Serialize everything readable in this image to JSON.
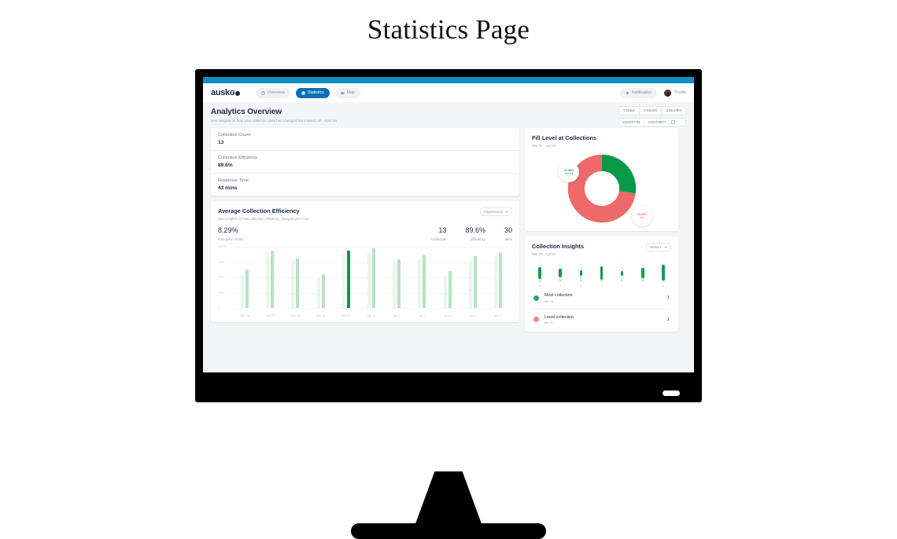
{
  "page": {
    "title": "Statistics Page"
  },
  "nav": {
    "logo": "ausko",
    "items": [
      {
        "label": "Overview",
        "icon": "dashboard-icon",
        "active": false
      },
      {
        "label": "Statistics",
        "icon": "chart-icon",
        "active": true
      },
      {
        "label": "Map",
        "icon": "map-icon",
        "active": false
      }
    ],
    "notification_label": "Notification",
    "profile_label": "Profile"
  },
  "header": {
    "title": "Analytics Overview",
    "subtitle": "See insights on how your collection data has changed from March 28 - April 28",
    "segments": [
      "7 Days",
      "1 Month",
      "3 Months"
    ],
    "date_from": "2022/07/31",
    "date_sep": "-",
    "date_to": "2022/08/07"
  },
  "stats": [
    {
      "label": "Collection Count",
      "value": "13"
    },
    {
      "label": "Collection Efficiency",
      "value": "89.6%"
    },
    {
      "label": "Response Time",
      "value": "43 mins"
    }
  ],
  "fill_level": {
    "title": "Fill Level at Collections",
    "range": "Mar 28 - Apr 01",
    "green_pct": "27.36%",
    "green_label": "Not full",
    "red_pct": "72.64%",
    "red_label": "Full",
    "green_color": "#089949",
    "red_color": "#ee6a6a"
  },
  "efficiency": {
    "title": "Average Collection Efficiency",
    "subtitle": "See insights on how collection efficiency changed over time",
    "dropdown": "Impressions",
    "main_value": "8.29%",
    "main_label": "from prev. month",
    "kpis": [
      {
        "value": "13",
        "label": "Collection"
      },
      {
        "value": "89.6%",
        "label": "Efficiency"
      },
      {
        "value": "30",
        "label": "Mins"
      }
    ]
  },
  "insights": {
    "title": "Collection Insights",
    "range": "Mar 28 - Apr 01",
    "dropdown": "Week 1",
    "rows": [
      {
        "title": "Most collection",
        "sub": "Bin 04",
        "count": "1",
        "color": "#2bab5d"
      },
      {
        "title": "Least collection",
        "sub": "Bin 01",
        "count": "1",
        "color": "#f4867f"
      }
    ]
  },
  "chart_data": [
    {
      "type": "bar",
      "title": "Average Collection Efficiency",
      "xlabel": "",
      "ylabel": "",
      "ylim": [
        0,
        100
      ],
      "ytick_labels": [
        "100 %",
        "75%",
        "50%",
        "25%",
        "0"
      ],
      "ytick_values": [
        100,
        75,
        50,
        25,
        0
      ],
      "grid": true,
      "categories": [
        "Mar 26",
        "Mar 27",
        "Mar 28",
        "Mar 29",
        "Mar 30",
        "Mar 31",
        "Apr 1",
        "Apr 2",
        "Apr 3",
        "Apr 4",
        "Apr 5"
      ],
      "series": [
        {
          "name": "Previous",
          "color": "#e9f6ee",
          "values": [
            54,
            91,
            78,
            49,
            87,
            90,
            75,
            80,
            53,
            77,
            85
          ]
        },
        {
          "name": "Current",
          "color": "#b7e2c6",
          "values": [
            63,
            94,
            81,
            55,
            93,
            97,
            79,
            86,
            60,
            84,
            90
          ]
        }
      ],
      "highlight": {
        "category": "Mar 30",
        "series": "Current",
        "color": "#089949",
        "value": 93
      }
    },
    {
      "type": "pie",
      "title": "Fill Level at Collections",
      "subtitle": "Mar 28 - Apr 01",
      "labels": [
        "Not full",
        "Full"
      ],
      "values": [
        27.36,
        72.64
      ],
      "value_labels": [
        "27.36%",
        "72.64%"
      ],
      "colors": [
        "#089949",
        "#ee6a6a"
      ],
      "donut": true
    },
    {
      "type": "bar",
      "title": "Collection Insights",
      "subtitle": "Mar 28 - Apr 01",
      "categories": [
        "M",
        "T",
        "W",
        "T",
        "F",
        "S",
        "S"
      ],
      "values": [
        62,
        48,
        30,
        72,
        26,
        55,
        82
      ],
      "color": "#159b48",
      "track_color": "#e3f4e9",
      "ylim": [
        0,
        100
      ]
    }
  ]
}
